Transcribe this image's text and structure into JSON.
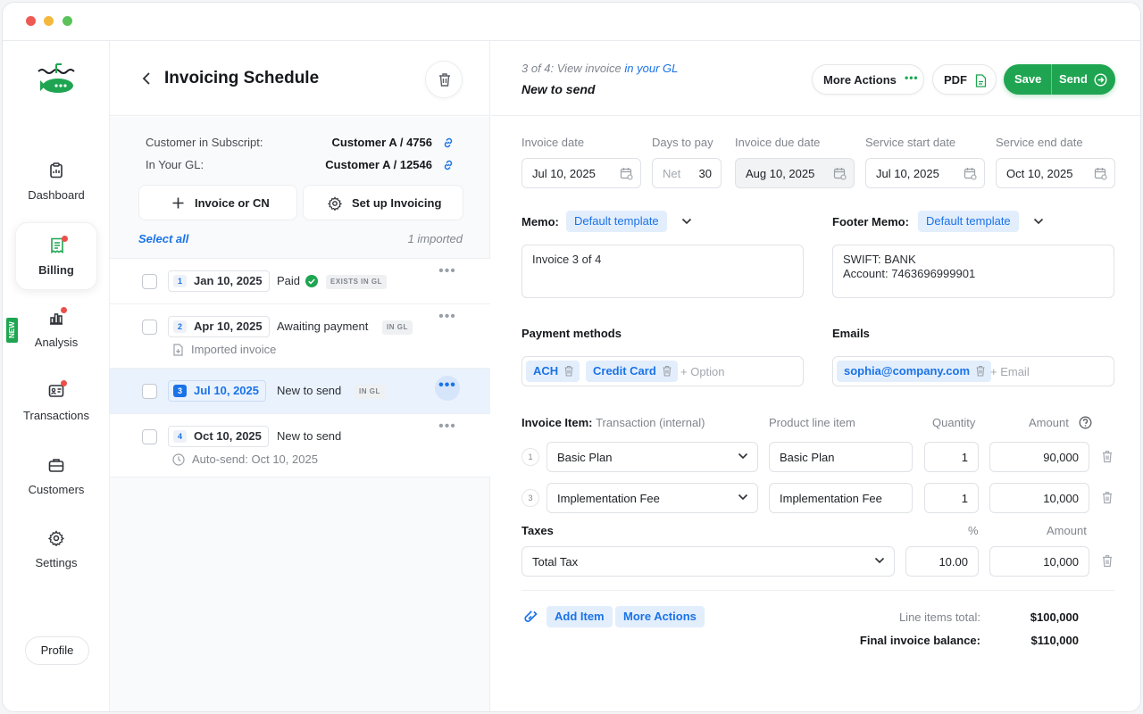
{
  "sidebar": {
    "items": [
      {
        "label": "Dashboard",
        "icon": "clipboard-icon"
      },
      {
        "label": "Billing",
        "icon": "receipt-icon",
        "badge": true
      },
      {
        "label": "Analysis",
        "icon": "bar-chart-icon",
        "badge": true,
        "new": "NEW"
      },
      {
        "label": "Transactions",
        "icon": "id-card-icon",
        "badge": true
      },
      {
        "label": "Customers",
        "icon": "briefcase-icon"
      },
      {
        "label": "Settings",
        "icon": "gear-icon"
      }
    ],
    "profile": "Profile"
  },
  "schedule": {
    "title": "Invoicing Schedule",
    "customer_subscript_label": "Customer in Subscript:",
    "customer_subscript_value": "Customer A / 4756",
    "gl_label": "In Your GL:",
    "gl_value": "Customer A / 12546",
    "invoice_btn": "Invoice or CN",
    "setup_btn": "Set up Invoicing",
    "select_all": "Select all",
    "imported_count": "1 imported",
    "rows": [
      {
        "num": "1",
        "date": "Jan 10, 2025",
        "status": "Paid",
        "badge": "EXISTS IN GL",
        "sub": ""
      },
      {
        "num": "2",
        "date": "Apr 10, 2025",
        "status": "Awaiting payment",
        "badge": "IN GL",
        "sub": "Imported invoice"
      },
      {
        "num": "3",
        "date": "Jul 10, 2025",
        "status": "New to send",
        "badge": "IN GL",
        "sub": ""
      },
      {
        "num": "4",
        "date": "Oct 10, 2025",
        "status": "New to send",
        "badge": "",
        "sub": "Auto-send: Oct 10, 2025"
      }
    ]
  },
  "invoice": {
    "step_prefix": "3 of 4: View invoice",
    "step_link": "in your GL",
    "title": "New to send",
    "more_actions": "More Actions",
    "pdf": "PDF",
    "save": "Save",
    "send": "Send",
    "fields": {
      "invoice_date_label": "Invoice date",
      "invoice_date": "Jul 10, 2025",
      "days_label": "Days to pay",
      "days_prefix": "Net",
      "days": "30",
      "due_label": "Invoice due date",
      "due": "Aug 10, 2025",
      "start_label": "Service start date",
      "start": "Jul 10, 2025",
      "end_label": "Service end date",
      "end": "Oct 10, 2025"
    },
    "memo_label": "Memo:",
    "memo_template": "Default template",
    "memo_text": "Invoice 3 of 4",
    "footer_label": "Footer Memo:",
    "footer_template": "Default template",
    "footer_text": "SWIFT: BANK\nAccount: 7463696999901",
    "payment_label": "Payment methods",
    "payment_tags": [
      "ACH",
      "Credit Card"
    ],
    "payment_placeholder": "+ Option",
    "emails_label": "Emails",
    "email_tag": "sophia@company.com",
    "email_placeholder": "+ Email",
    "items_label": "Invoice Item:",
    "items_sub": "Transaction (internal)",
    "product_col": "Product line item",
    "qty_col": "Quantity",
    "amount_col": "Amount",
    "items": [
      {
        "num": "1",
        "transaction": "Basic Plan",
        "product": "Basic Plan",
        "qty": "1",
        "amount": "90,000"
      },
      {
        "num": "3",
        "transaction": "Implementation Fee",
        "product": "Implementation Fee",
        "qty": "1",
        "amount": "10,000"
      }
    ],
    "taxes_label": "Taxes",
    "pct_col": "%",
    "tax_amount_col": "Amount",
    "tax": {
      "name": "Total Tax",
      "pct": "10.00",
      "amount": "10,000"
    },
    "add_item": "Add Item",
    "more_actions_footer": "More Actions",
    "line_total_label": "Line items total:",
    "line_total": "$100,000",
    "final_label": "Final invoice balance:",
    "final": "$110,000"
  },
  "colors": {
    "accent": "#1a73e8",
    "brand": "#1fa551",
    "badge": "#e9504a"
  }
}
